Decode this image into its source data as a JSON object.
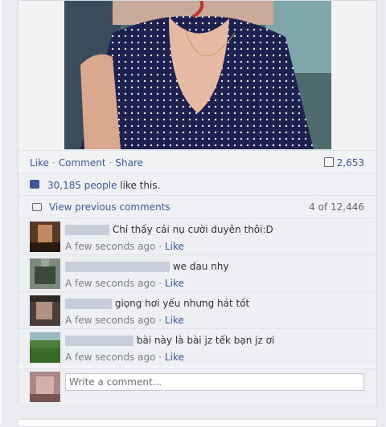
{
  "post": {
    "actions": {
      "like": "Like",
      "comment": "Comment",
      "share": "Share",
      "separator": "·",
      "share_count": "2,653"
    },
    "likes": {
      "count_text": "30,185 people",
      "suffix": " like this."
    },
    "comments_nav": {
      "view_previous": "View previous comments",
      "count": "4 of 12,446"
    }
  },
  "comments": [
    {
      "text": "Chỉ thấy cái nụ cười duyên thôi:D",
      "time": "A few seconds ago",
      "sep": "·",
      "like": "Like"
    },
    {
      "text": "we dau nhy",
      "time": "A few seconds ago",
      "sep": "·",
      "like": "Like"
    },
    {
      "text": "giọng hơi yếu nhưng hát tốt",
      "time": "A few seconds ago",
      "sep": "·",
      "like": "Like"
    },
    {
      "text": "bài này là bài jz tếk bạn jz ơi",
      "time": "A few seconds ago",
      "sep": "·",
      "like": "Like"
    }
  ],
  "composer": {
    "placeholder": "Write a comment..."
  },
  "colors": {
    "link": "#3b5998",
    "page_bg": "#e9ebee",
    "card_bg": "#f2f3f5"
  },
  "icons": [
    "share-count-icon",
    "like-thumb-icon",
    "comment-bubble-icon"
  ]
}
